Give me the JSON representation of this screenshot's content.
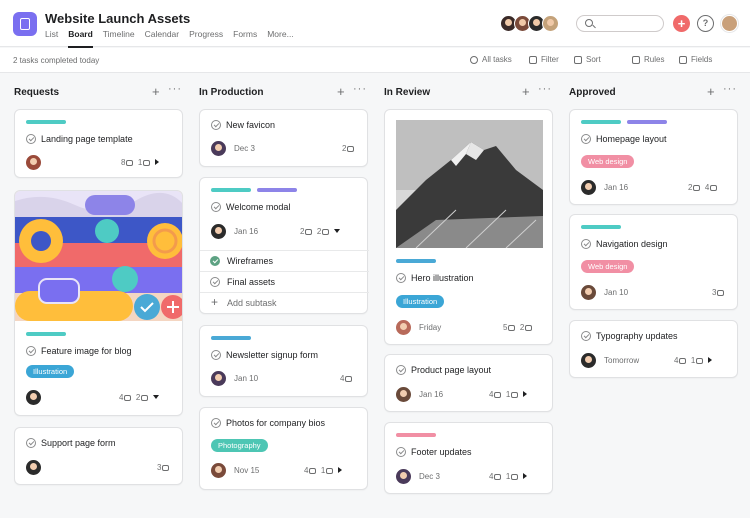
{
  "project": {
    "title": "Website Launch Assets",
    "nav": [
      "List",
      "Board",
      "Timeline",
      "Calendar",
      "Progress",
      "Forms",
      "More..."
    ],
    "active_nav": "Board"
  },
  "toolbar": {
    "completed": "2 tasks completed today",
    "all_tasks": "All tasks",
    "filter": "Filter",
    "sort": "Sort",
    "rules": "Rules",
    "fields": "Fields"
  },
  "colors": {
    "accent": "#7a6ff0",
    "red": "#f06a6a",
    "teal": "#4ecbc4",
    "purple": "#8d84e8",
    "blue": "#4aa9d6",
    "green": "#5da283",
    "pink": "#f9aaef",
    "tag_pink": "#f18fa4",
    "tag_blue": "#3ba6d6",
    "tag_teal": "#4ec6b4"
  },
  "columns": [
    {
      "title": "Requests",
      "cards": [
        {
          "name": "Landing page template",
          "meta": "8",
          "meta2": "1"
        },
        {
          "name": "Feature image for blog",
          "tag": "Illustration",
          "meta": "4",
          "meta2": "2"
        },
        {
          "name": "Support page form",
          "meta": "3"
        }
      ]
    },
    {
      "title": "In Production",
      "cards": [
        {
          "name": "New favicon",
          "date": "Dec 3",
          "meta": "2"
        },
        {
          "name": "Welcome modal",
          "date": "Jan 16",
          "meta": "2",
          "meta2": "2",
          "subtasks": [
            "Wireframes",
            "Final assets"
          ],
          "add_subtask": "Add subtask"
        },
        {
          "name": "Newsletter signup form",
          "date": "Jan 10",
          "meta": "4"
        },
        {
          "name": "Photos for company bios",
          "tag": "Photography",
          "date": "Nov 15",
          "meta": "4",
          "meta2": "1"
        }
      ]
    },
    {
      "title": "In Review",
      "cards": [
        {
          "name": "Hero illustration",
          "tag": "Illustration",
          "date": "Friday",
          "meta": "5",
          "meta2": "2"
        },
        {
          "name": "Product page layout",
          "date": "Jan 16",
          "meta": "4",
          "meta2": "1"
        },
        {
          "name": "Footer updates",
          "date": "Dec 3",
          "meta": "4",
          "meta2": "1"
        }
      ]
    },
    {
      "title": "Approved",
      "cards": [
        {
          "name": "Homepage layout",
          "tag": "Web design",
          "date": "Jan 16",
          "meta": "2",
          "meta2": "4"
        },
        {
          "name": "Navigation design",
          "tag": "Web design",
          "date": "Jan 10",
          "meta": "3"
        },
        {
          "name": "Typography updates",
          "date": "Tomorrow",
          "meta": "4",
          "meta2": "1"
        }
      ]
    }
  ]
}
